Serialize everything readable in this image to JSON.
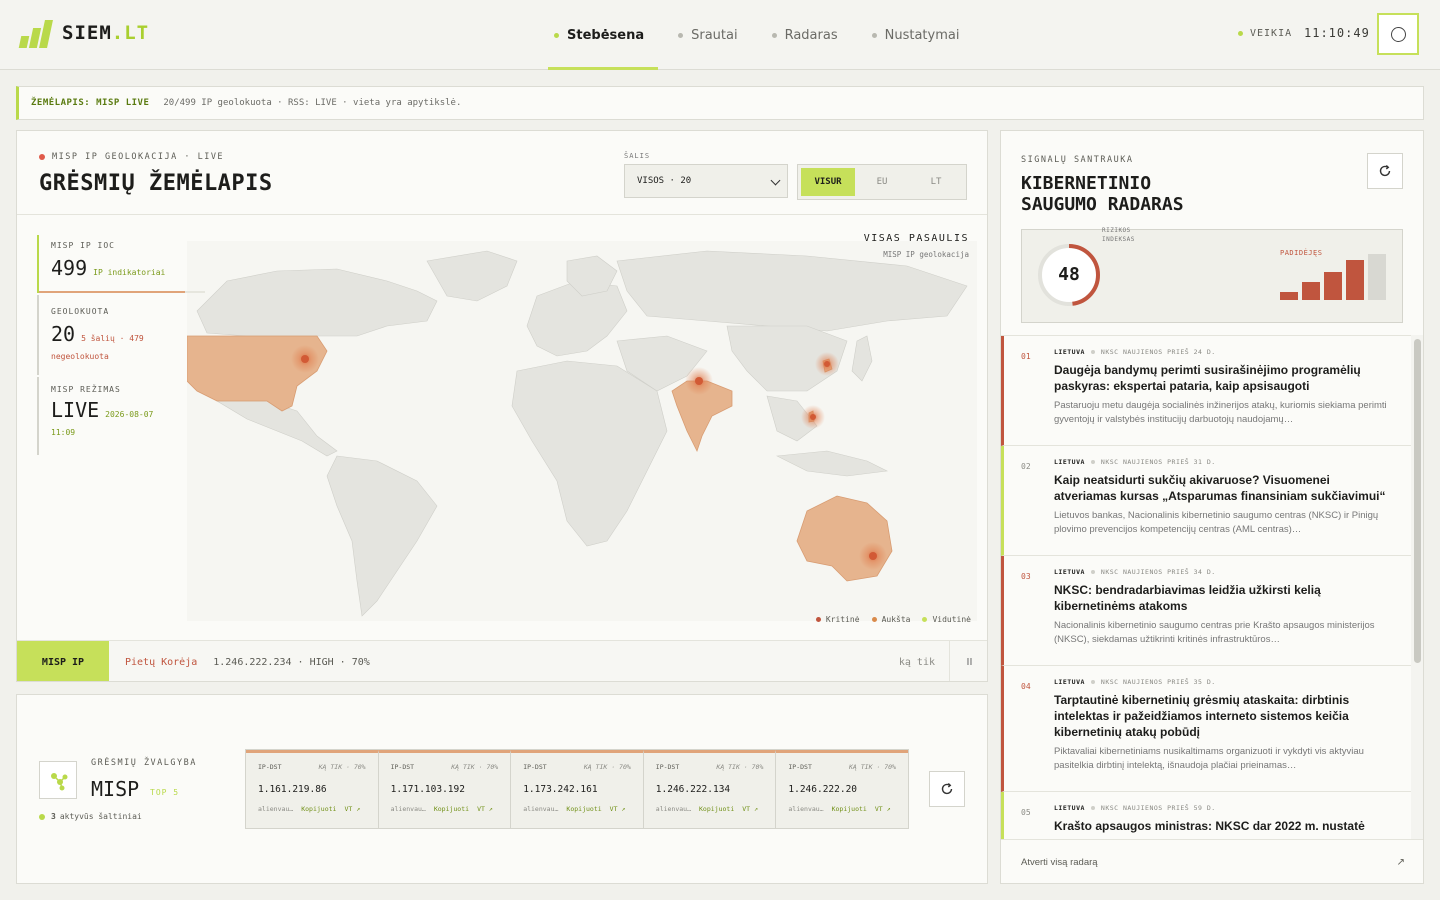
{
  "app": {
    "logo_main": "SIEM",
    "logo_accent": ".LT",
    "nav": [
      {
        "label": "Stebėsena",
        "active": true
      },
      {
        "label": "Srautai",
        "active": false
      },
      {
        "label": "Radaras",
        "active": false
      },
      {
        "label": "Nustatymai",
        "active": false
      }
    ],
    "status": "VEIKIA",
    "clock": "11:10:49",
    "user_icon": "circle-icon"
  },
  "ticker": {
    "label": "ŽEMĖLAPIS: MISP LIVE",
    "text": "20/499 IP geolokuota · RSS: LIVE · vieta yra apytikslė."
  },
  "map": {
    "eyebrow": "MISP IP GEOLOKACIJA · LIVE",
    "title": "GRĖSMIŲ ŽEMĖLAPIS",
    "country_label": "ŠALIS",
    "country_value": "VISOS · 20",
    "scope": [
      "VISUR",
      "EU",
      "LT"
    ],
    "scope_active": "VISUR",
    "stats": {
      "ioc_label": "MISP IP IOC",
      "ioc_value": "499",
      "ioc_sub": "IP indikatoriai",
      "ioc_geolocated_fraction": 0.04,
      "geo_label": "GEOLOKUOTA",
      "geo_value": "20",
      "geo_sub": "5 šalių · 479",
      "geo_sub2": "negeolokuota",
      "mode_label": "MISP REŽIMAS",
      "mode_value": "LIVE",
      "mode_date": "2026-08-07",
      "mode_time": "11:09"
    },
    "region_title": "VISAS PASAULIS",
    "region_sub": "MISP IP geolokacija",
    "legend": [
      {
        "label": "Kritinė",
        "color": "#c0553e"
      },
      {
        "label": "Aukšta",
        "color": "#d98a4a"
      },
      {
        "label": "Vidutinė",
        "color": "#c6e05a"
      }
    ],
    "footer": {
      "tag": "MISP IP",
      "country": "Pietų Korėja",
      "info": "1.246.222.234 · HIGH · 70%",
      "time": "ką tik",
      "pause_icon": "pause-icon"
    }
  },
  "intel": {
    "eyebrow": "GRĖSMIŲ ŽVALGYBA",
    "title": "MISP",
    "top": "TOP 5",
    "sources_count": "3",
    "sources_text": "aktyvūs šaltiniai",
    "cards": [
      {
        "type": "IP-DST",
        "meta": "KĄ TIK · 70%",
        "ip": "1.161.219.86",
        "a1": "alienvau…",
        "a2": "Kopijuoti",
        "a3": "VT ↗"
      },
      {
        "type": "IP-DST",
        "meta": "KĄ TIK · 70%",
        "ip": "1.171.103.192",
        "a1": "alienvau…",
        "a2": "Kopijuoti",
        "a3": "VT ↗"
      },
      {
        "type": "IP-DST",
        "meta": "KĄ TIK · 70%",
        "ip": "1.173.242.161",
        "a1": "alienvau…",
        "a2": "Kopijuoti",
        "a3": "VT ↗"
      },
      {
        "type": "IP-DST",
        "meta": "KĄ TIK · 70%",
        "ip": "1.246.222.134",
        "a1": "alienvau…",
        "a2": "Kopijuoti",
        "a3": "VT ↗"
      },
      {
        "type": "IP-DST",
        "meta": "KĄ TIK · 70%",
        "ip": "1.246.222.20",
        "a1": "alienvau…",
        "a2": "Kopijuoti",
        "a3": "VT ↗"
      }
    ]
  },
  "radar": {
    "eyebrow": "SIGNALŲ SANTRAUKA",
    "title_line1": "KIBERNETINIO",
    "title_line2": "SAUGUMO RADARAS",
    "risk_label1": "RIZIKOS",
    "risk_label2": "INDEKSAS",
    "risk_value": "48",
    "risk_level": "PADIDĖJĘS",
    "news": [
      {
        "num": "01",
        "country": "LIETUVA",
        "source": "NKSC NAUJIENOS",
        "age": "PRIEŠ 24 D.",
        "title": "Daugėja bandymų perimti susirašinėjimo programėlių paskyras: ekspertai pataria, kaip apsisaugoti",
        "desc": "Pastaruoju metu daugėja socialinės inžinerijos atakų, kuriomis siekiama perimti gyventojų ir valstybės institucijų darbuotojų naudojamų…",
        "level": "critical"
      },
      {
        "num": "02",
        "country": "LIETUVA",
        "source": "NKSC NAUJIENOS",
        "age": "PRIEŠ 31 D.",
        "title": "Kaip neatsidurti sukčių akivaruose? Visuomenei atveriamas kursas „Atsparumas finansiniam sukčiavimui“",
        "desc": "Lietuvos bankas, Nacionalinis kibernetinio saugumo centras (NKSC) ir Pinigų plovimo prevencijos kompetencijų centras (AML centras)…",
        "level": "medium"
      },
      {
        "num": "03",
        "country": "LIETUVA",
        "source": "NKSC NAUJIENOS",
        "age": "PRIEŠ 34 D.",
        "title": "NKSC: bendradarbiavimas leidžia užkirsti kelią kibernetinėms atakoms",
        "desc": "Nacionalinis kibernetinio saugumo centras prie Krašto apsaugos ministerijos (NKSC), siekdamas užtikrinti kritinės infrastruktūros…",
        "level": "critical"
      },
      {
        "num": "04",
        "country": "LIETUVA",
        "source": "NKSC NAUJIENOS",
        "age": "PRIEŠ 35 D.",
        "title": "Tarptautinė kibernetinių grėsmių ataskaita: dirbtinis intelektas ir pažeidžiamos interneto sistemos keičia kibernetinių atakų pobūdį",
        "desc": "Piktavaliai kibernetiniams nusikaltimams organizuoti ir vykdyti vis aktyviau pasitelkia dirbtinį intelektą, išnaudoja plačiai prieinamas…",
        "level": "critical"
      },
      {
        "num": "05",
        "country": "LIETUVA",
        "source": "NKSC NAUJIENOS",
        "age": "PRIEŠ 59 D.",
        "title": "Krašto apsaugos ministras: NKSC dar 2022 m. nustatė",
        "desc": "",
        "level": "medium"
      }
    ],
    "footer": "Atverti visą radarą",
    "footer_icon": "arrow-up-right-icon"
  },
  "colors": {
    "accent": "#c6e05a",
    "critical": "#c0553e",
    "high": "#d98a4a",
    "country_fill": "#e6b48e"
  }
}
